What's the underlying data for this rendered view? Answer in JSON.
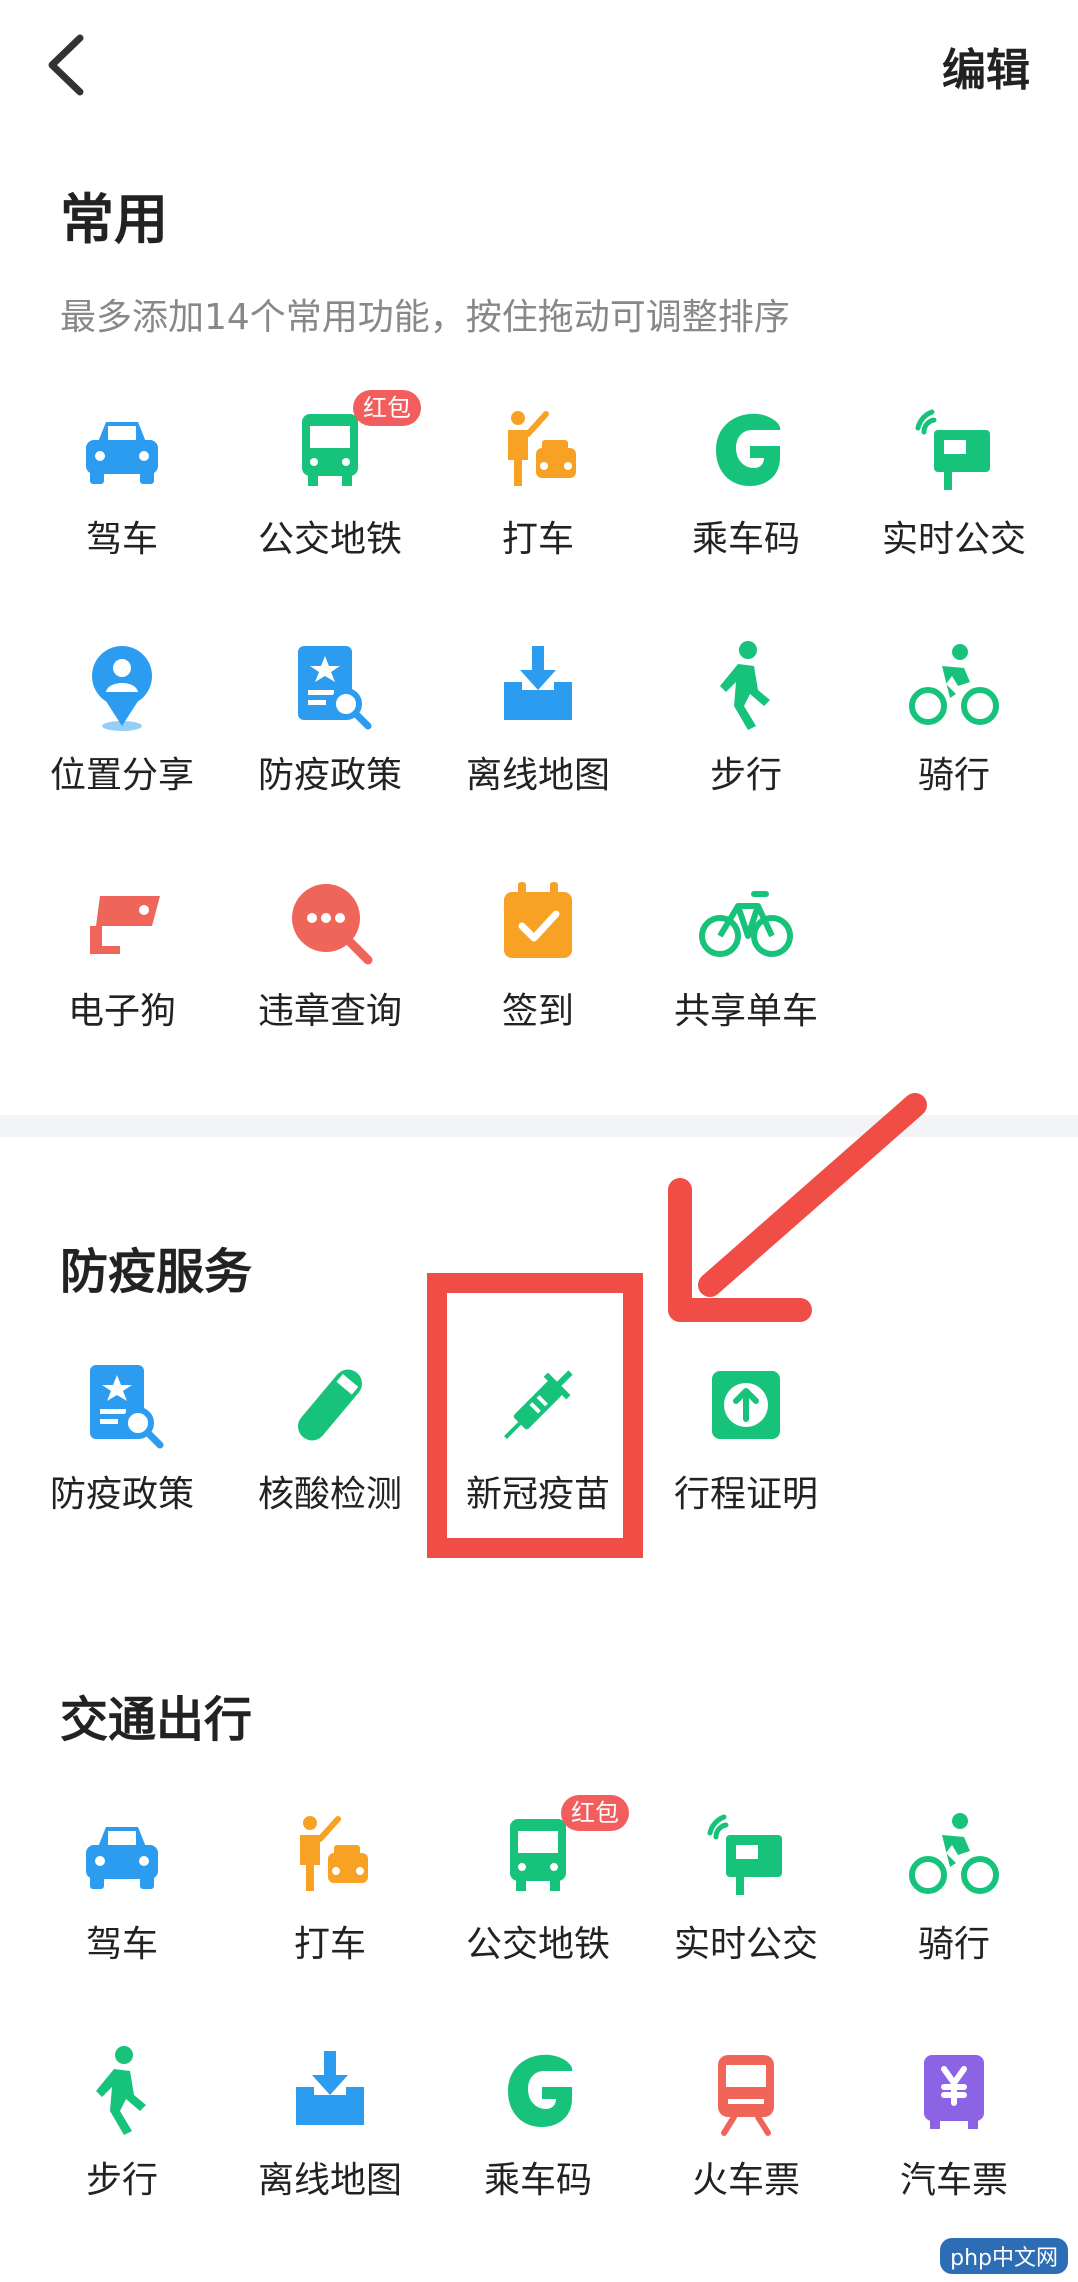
{
  "header": {
    "edit_label": "编辑"
  },
  "frequent": {
    "title": "常用",
    "subtitle": "最多添加14个常用功能，按住拖动可调整排序",
    "items": [
      {
        "label": "驾车",
        "icon": "car-icon"
      },
      {
        "label": "公交地铁",
        "icon": "bus-icon",
        "badge": "红包"
      },
      {
        "label": "打车",
        "icon": "taxi-icon"
      },
      {
        "label": "乘车码",
        "icon": "ride-code-icon"
      },
      {
        "label": "实时公交",
        "icon": "realtime-bus-icon"
      },
      {
        "label": "位置分享",
        "icon": "location-share-icon"
      },
      {
        "label": "防疫政策",
        "icon": "policy-doc-icon"
      },
      {
        "label": "离线地图",
        "icon": "offline-map-icon"
      },
      {
        "label": "步行",
        "icon": "walk-icon"
      },
      {
        "label": "骑行",
        "icon": "cycling-icon"
      },
      {
        "label": "电子狗",
        "icon": "camera-icon"
      },
      {
        "label": "违章查询",
        "icon": "violation-search-icon"
      },
      {
        "label": "签到",
        "icon": "checkin-calendar-icon"
      },
      {
        "label": "共享单车",
        "icon": "bike-icon"
      }
    ]
  },
  "epidemic": {
    "title": "防疫服务",
    "items": [
      {
        "label": "防疫政策",
        "icon": "policy-doc-icon"
      },
      {
        "label": "核酸检测",
        "icon": "test-tube-icon"
      },
      {
        "label": "新冠疫苗",
        "icon": "syringe-icon"
      },
      {
        "label": "行程证明",
        "icon": "trip-proof-icon"
      }
    ]
  },
  "transport": {
    "title": "交通出行",
    "items": [
      {
        "label": "驾车",
        "icon": "car-icon"
      },
      {
        "label": "打车",
        "icon": "taxi-icon"
      },
      {
        "label": "公交地铁",
        "icon": "bus-icon",
        "badge": "红包"
      },
      {
        "label": "实时公交",
        "icon": "realtime-bus-icon"
      },
      {
        "label": "骑行",
        "icon": "cycling-icon"
      },
      {
        "label": "步行",
        "icon": "walk-icon"
      },
      {
        "label": "离线地图",
        "icon": "offline-map-icon"
      },
      {
        "label": "乘车码",
        "icon": "ride-code-icon"
      },
      {
        "label": "火车票",
        "icon": "train-icon"
      },
      {
        "label": "汽车票",
        "icon": "coach-ticket-icon"
      }
    ]
  },
  "watermark": "php中文网",
  "colors": {
    "blue": "#2b9cf0",
    "green": "#17c27a",
    "orange": "#f7a125",
    "red": "#ef4d45",
    "purple": "#8d63e6"
  }
}
